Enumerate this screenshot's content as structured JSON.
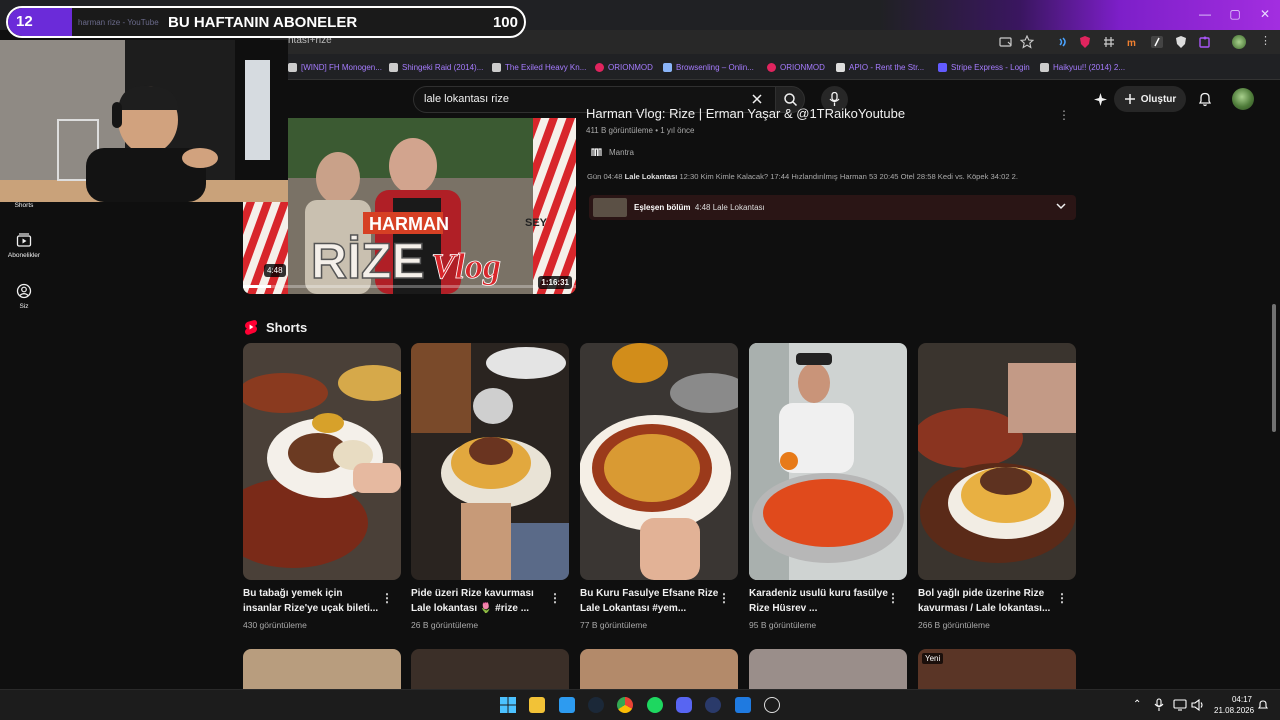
{
  "overlay": {
    "counter": "12",
    "title": "BU HAFTANIN ABONELER",
    "count": "100",
    "ghost_tab": "harman rize - YouTube"
  },
  "browser": {
    "omnibox": "ntası+rize",
    "bookmarks": [
      {
        "label": "[WIND] FH Monogen...",
        "color": "#8ab4f8"
      },
      {
        "label": "Shingeki Raid (2014)...",
        "color": "#8ab4f8"
      },
      {
        "label": "The Exiled Heavy Kn...",
        "color": "#8ab4f8"
      },
      {
        "label": "ORIONMOD",
        "color": "#e0245e"
      },
      {
        "label": "Browsenling – Onlin...",
        "color": "#8ab4f8"
      },
      {
        "label": "ORIONMOD",
        "color": "#e0245e"
      },
      {
        "label": "APIO - Rent the Str...",
        "color": "#8ab4f8"
      },
      {
        "label": "Stripe Express - Login",
        "color": "#635bff"
      },
      {
        "label": "Haikyuu!! (2014) 2...",
        "color": "#8ab4f8"
      }
    ]
  },
  "youtube": {
    "search_query": "lale lokantası rize",
    "create_label": "Oluştur",
    "sidebar": [
      {
        "label": "Shorts",
        "icon": "shorts-icon"
      },
      {
        "label": "Abonelikler",
        "icon": "subscriptions-icon"
      },
      {
        "label": "Siz",
        "icon": "you-icon"
      }
    ],
    "video": {
      "title": "Harman Vlog: Rize | Erman Yaşar & @1TRaikoYoutube",
      "meta": "411 B görüntüleme • 1 yıl önce",
      "channel": "Mantra",
      "duration": "1:16:31",
      "clip_time": "4:48",
      "progress": 0.085,
      "chapters_pre": "Gün 04:48 ",
      "chapters_bold": "Lale Lokantası",
      "chapters_post": " 12:30 Kim Kimle Kalacak? 17:44 Hızlandırılmış Harman 53 20:45 Otel 28:58 Kedi vs. Köpek 34:02 2.",
      "match_bold": "Eşleşen bölüm",
      "match_text": "4:48 Lale Lokantası"
    },
    "shorts_heading": "Shorts",
    "shorts": [
      {
        "title": "Bu tabağı yemek için insanlar Rize'ye uçak bileti...",
        "views": "430 görüntüleme"
      },
      {
        "title": "Pide üzeri Rize kavurması Lale lokantası 🌷 #rize ...",
        "views": "26 B görüntüleme"
      },
      {
        "title": "Bu Kuru Fasulye Efsane Rize Lale Lokantası #yem...",
        "views": "77 B görüntüleme"
      },
      {
        "title": "Karadeniz usulü kuru fasülye Rize Hüsrev ...",
        "views": "95 B görüntüleme"
      },
      {
        "title": "Bol yağlı pide üzerine Rize kavurması / Lale lokantası...",
        "views": "266 B görüntüleme"
      }
    ],
    "new_badge": "Yeni"
  },
  "taskbar": {
    "time": "04:17",
    "date": "21.08.2026"
  },
  "colors": {
    "accent_purple": "#6b2bd9",
    "youtube_red": "#ff0000",
    "match_bg": "#2a1515"
  }
}
